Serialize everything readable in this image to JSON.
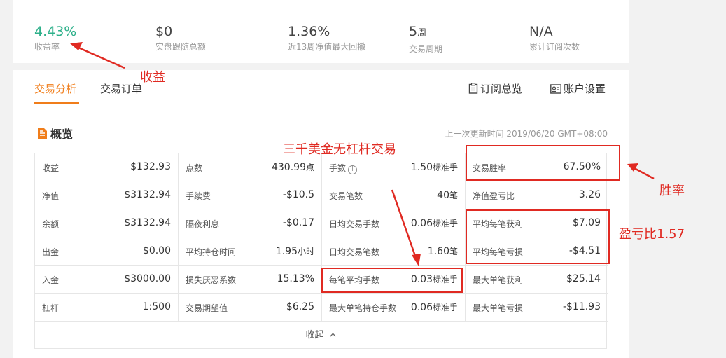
{
  "top_stats": [
    {
      "value": "4.43%",
      "unit": "",
      "label": "收益率"
    },
    {
      "value": "$0",
      "unit": "",
      "label": "实盘跟随总额"
    },
    {
      "value": "1.36%",
      "unit": "",
      "label": "近13周净值最大回撤"
    },
    {
      "value": "5",
      "unit": "周",
      "label": "交易周期"
    },
    {
      "value": "N/A",
      "unit": "",
      "label": "累计订阅次数"
    }
  ],
  "tabs": [
    "交易分析",
    "交易订单"
  ],
  "tools": {
    "subscription": "订阅总览",
    "account": "账户设置"
  },
  "section": {
    "title": "概览",
    "update": "上一次更新时间 2019/06/20 GMT+08:00"
  },
  "table": [
    [
      {
        "k": "收益",
        "v": "$132.93",
        "u": ""
      },
      {
        "k": "点数",
        "v": "430.99",
        "u": "点"
      },
      {
        "k": "手数",
        "v": "1.50",
        "u": "标准手"
      },
      {
        "k": "交易胜率",
        "v": "67.50%",
        "u": ""
      }
    ],
    [
      {
        "k": "净值",
        "v": "$3132.94",
        "u": ""
      },
      {
        "k": "手续费",
        "v": "-$10.5",
        "u": ""
      },
      {
        "k": "交易笔数",
        "v": "40",
        "u": "笔"
      },
      {
        "k": "净值盈亏比",
        "v": "3.26",
        "u": ""
      }
    ],
    [
      {
        "k": "余额",
        "v": "$3132.94",
        "u": ""
      },
      {
        "k": "隔夜利息",
        "v": "-$0.17",
        "u": ""
      },
      {
        "k": "日均交易手数",
        "v": "0.06",
        "u": "标准手"
      },
      {
        "k": "平均每笔获利",
        "v": "$7.09",
        "u": ""
      }
    ],
    [
      {
        "k": "出金",
        "v": "$0.00",
        "u": ""
      },
      {
        "k": "平均持仓时间",
        "v": "1.95",
        "u": "小时"
      },
      {
        "k": "日均交易笔数",
        "v": "1.60",
        "u": "笔"
      },
      {
        "k": "平均每笔亏损",
        "v": "-$4.51",
        "u": ""
      }
    ],
    [
      {
        "k": "入金",
        "v": "$3000.00",
        "u": ""
      },
      {
        "k": "损失厌恶系数",
        "v": "15.13%",
        "u": ""
      },
      {
        "k": "每笔平均手数",
        "v": "0.03",
        "u": "标准手"
      },
      {
        "k": "最大单笔获利",
        "v": "$25.14",
        "u": ""
      }
    ],
    [
      {
        "k": "杠杆",
        "v": "1:500",
        "u": ""
      },
      {
        "k": "交易期望值",
        "v": "$6.25",
        "u": ""
      },
      {
        "k": "最大单笔持仓手数",
        "v": "0.06",
        "u": "标准手"
      },
      {
        "k": "最大单笔亏损",
        "v": "-$11.93",
        "u": ""
      }
    ]
  ],
  "collapse_label": "收起",
  "annotations": {
    "profit": "收益",
    "capital": "三千美金无杠杆交易",
    "win_rate": "胜率",
    "ratio": "盈亏比1.57"
  },
  "colors": {
    "accent": "#f07d1a",
    "green": "#2db08a",
    "annotation": "#e02a22"
  }
}
